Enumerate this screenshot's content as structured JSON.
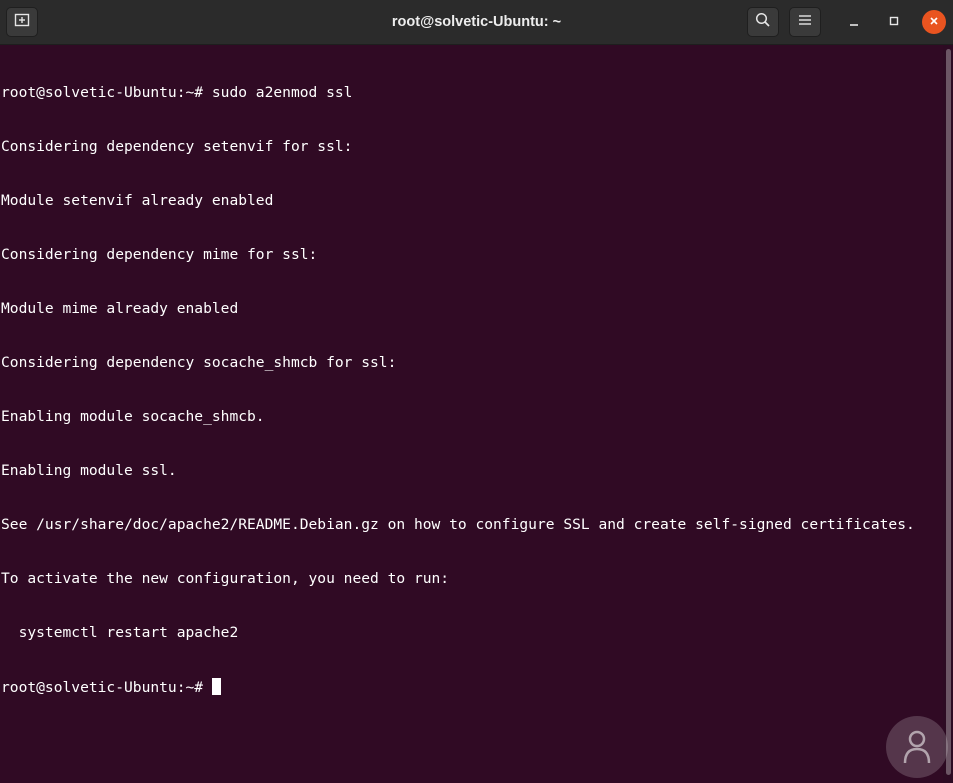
{
  "window": {
    "title": "root@solvetic-Ubuntu: ~"
  },
  "titlebar": {
    "new_tab_icon": "new-tab-icon",
    "search_icon": "search-icon",
    "menu_icon": "hamburger-menu-icon",
    "minimize_icon": "minimize-icon",
    "maximize_icon": "maximize-icon",
    "close_icon": "close-icon"
  },
  "terminal": {
    "lines": [
      "root@solvetic-Ubuntu:~# sudo a2enmod ssl",
      "Considering dependency setenvif for ssl:",
      "Module setenvif already enabled",
      "Considering dependency mime for ssl:",
      "Module mime already enabled",
      "Considering dependency socache_shmcb for ssl:",
      "Enabling module socache_shmcb.",
      "Enabling module ssl.",
      "See /usr/share/doc/apache2/README.Debian.gz on how to configure SSL and create self-signed certificates.",
      "To activate the new configuration, you need to run:",
      "  systemctl restart apache2"
    ],
    "prompt": "root@solvetic-Ubuntu:~# "
  },
  "colors": {
    "terminal_bg": "#300a24",
    "titlebar_bg": "#2b2b2b",
    "close_button": "#e95420",
    "text": "#ffffff"
  }
}
